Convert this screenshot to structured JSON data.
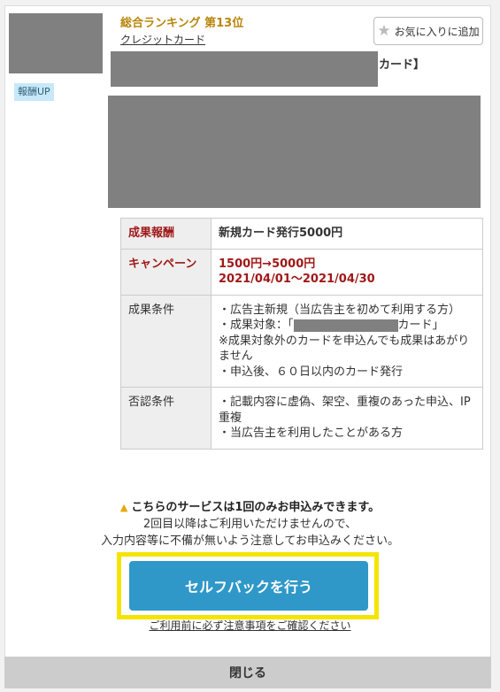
{
  "header": {
    "rank": "総合ランキング 第13位",
    "category": "クレジットカード",
    "badge": "報酬UP",
    "favorite_label": "お気に入りに追加",
    "title_suffix": "カード】"
  },
  "table": {
    "rows": [
      {
        "label": "成果報酬",
        "value": "新規カード発行5000円"
      },
      {
        "label": "キャンペーン",
        "value_lines": [
          "1500円→5000円",
          "2021/04/01～2021/04/30"
        ]
      },
      {
        "label": "成果条件",
        "value_lines": [
          "・広告主新規（当広告主を初めて利用する方）",
          "・成果対象：「",
          "カード」",
          "※成果対象外のカードを申込んでも成果はあがりません",
          "・申込後、６０日以内のカード発行"
        ]
      },
      {
        "label": "否認条件",
        "value_lines": [
          "・記載内容に虚偽、架空、重複のあった申込、IP重複",
          "・当広告主を利用したことがある方"
        ]
      }
    ]
  },
  "notice": {
    "main": "こちらのサービスは1回のみお申込みできます。",
    "line2": "2回目以降はご利用いただけませんので、",
    "line3": "入力内容等に不備が無いよう注意してお申込みください。"
  },
  "cta_label": "セルフバックを行う",
  "note_link": "ご利用前に必ず注意事項をご確認ください",
  "close_label": "閉じる",
  "colors": {
    "accent": "#2f98c8",
    "highlight": "#f5e400",
    "reward_red": "#a01818",
    "rank_gold": "#b8860b"
  }
}
